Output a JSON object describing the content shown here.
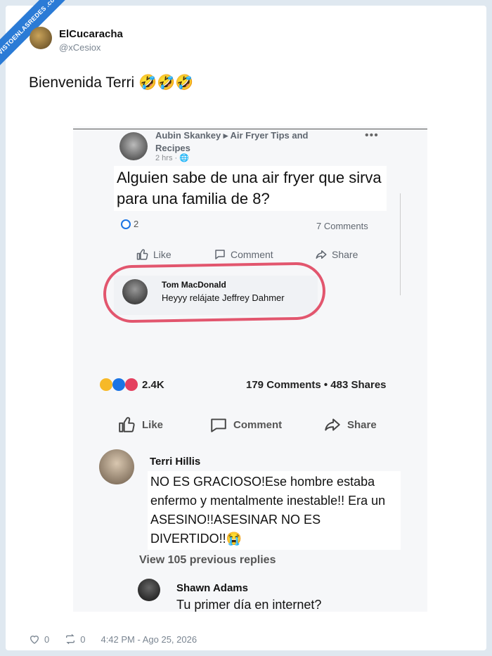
{
  "watermark": {
    "text": "VISTOENLASREDES .com"
  },
  "author": {
    "name": "ElCucaracha",
    "handle": "@xCesiox"
  },
  "tweet": {
    "text": "Bienvenida Terri 🤣🤣🤣"
  },
  "embedded": {
    "post_header": "Aubin Skankey ▸ Air Fryer Tips and Recipes",
    "post_time": "2 hrs · 🌐",
    "post_menu": "•••",
    "post_text": "Alguien sabe de una air fryer que sirva para una familia de 8?",
    "reaction_count": "2",
    "comments_count": "7 Comments",
    "actions": {
      "like": "Like",
      "comment": "Comment",
      "share": "Share"
    },
    "highlight_comment": {
      "name": "Tom MacDonald",
      "text": "Heyyy relájate Jeffrey Dahmer"
    },
    "stats": {
      "reactions": "2.4K",
      "comments_shares": "179 Comments • 483 Shares"
    },
    "actions2": {
      "like": "Like",
      "comment": "Comment",
      "share": "Share"
    },
    "reply1": {
      "name": "Terri Hillis",
      "text": "NO ES GRACIOSO!Ese hombre estaba  enfermo y mentalmente inestable!! Era un ASESINO!!ASESINAR NO ES DIVERTIDO!!😭"
    },
    "view_previous": "View 105 previous replies",
    "reply2": {
      "name": "Shawn Adams",
      "text": "Tu primer día en internet?"
    }
  },
  "footer": {
    "likes": "0",
    "retweets": "0",
    "timestamp": "4:42 PM - Ago 25, 2026"
  },
  "colors": {
    "annotation": "#e2566e",
    "watermark": "#2b7bd6",
    "fb_blue": "#1b74e4"
  }
}
